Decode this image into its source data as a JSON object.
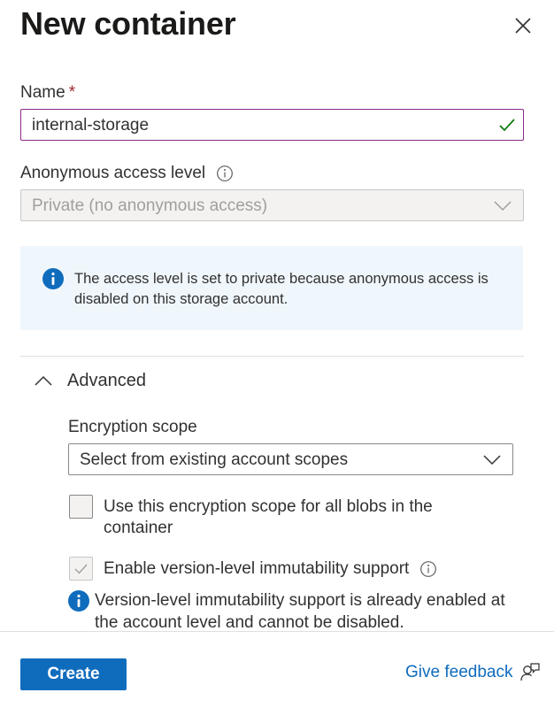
{
  "panel": {
    "title": "New container",
    "close_icon": "close-icon"
  },
  "name_field": {
    "label": "Name",
    "required_marker": "*",
    "value": "internal-storage",
    "valid_icon": "checkmark-icon",
    "border_color": "#8a2b86"
  },
  "access_level": {
    "label": "Anonymous access level",
    "info_icon": "info-icon",
    "selected": "Private (no anonymous access)",
    "disabled": true
  },
  "info_message": {
    "icon": "info-icon",
    "text": "The access level is set to private because anonymous access is disabled on this storage account."
  },
  "advanced": {
    "label": "Advanced",
    "expanded": true,
    "encryption_scope": {
      "label": "Encryption scope",
      "selected": "Select from existing account scopes"
    },
    "use_scope_checkbox": {
      "label": "Use this encryption scope for all blobs in the container",
      "checked": false
    },
    "immutability_checkbox": {
      "label": "Enable version-level immutability support",
      "checked": true,
      "disabled": true,
      "info_icon": "info-icon"
    },
    "immutability_note": "Version-level immutability support is already enabled at the account level and cannot be disabled."
  },
  "footer": {
    "create_label": "Create",
    "feedback_label": "Give feedback",
    "feedback_icon": "feedback-person-icon"
  },
  "colors": {
    "primary": "#0f6cbd",
    "info_bg": "#eff6fc",
    "success": "#107c10",
    "required": "#a4262c"
  }
}
